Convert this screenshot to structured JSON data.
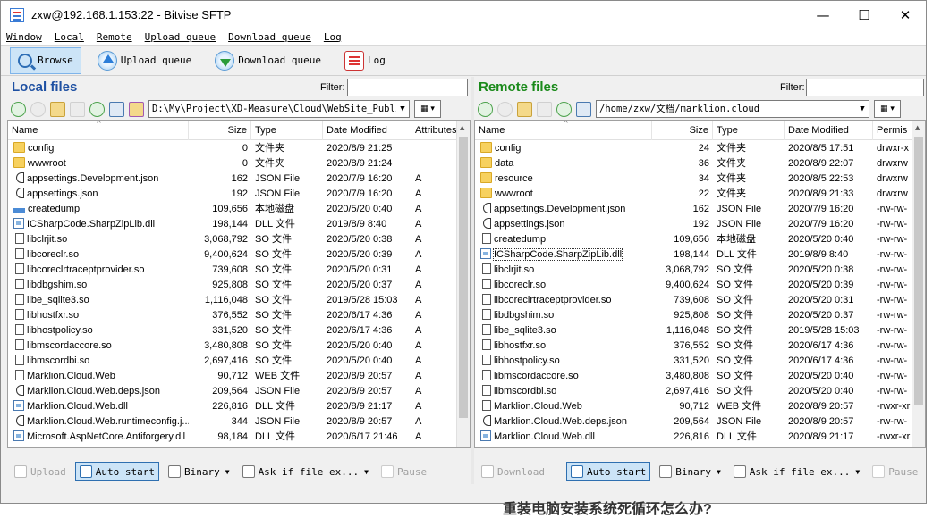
{
  "window": {
    "title": "zxw@192.168.1.153:22 - Bitvise SFTP",
    "minimize": "—",
    "maximize": "☐",
    "close": "✕"
  },
  "menu": [
    "Window",
    "Local",
    "Remote",
    "Upload queue",
    "Download queue",
    "Log"
  ],
  "toolbar": {
    "browse": "Browse",
    "upload_queue": "Upload queue",
    "download_queue": "Download queue",
    "log": "Log"
  },
  "local": {
    "title": "Local files",
    "filter_label": "Filter:",
    "filter_value": "",
    "path": "D:\\My\\Project\\XD-Measure\\Cloud\\WebSite_Publish",
    "columns": [
      "Name",
      "Size",
      "Type",
      "Date Modified",
      "Attributes"
    ],
    "rows": [
      {
        "icon": "folder",
        "name": "config",
        "size": "0",
        "type": "文件夹",
        "date": "2020/8/9 21:25",
        "attr": ""
      },
      {
        "icon": "folder",
        "name": "wwwroot",
        "size": "0",
        "type": "文件夹",
        "date": "2020/8/9 21:24",
        "attr": ""
      },
      {
        "icon": "json",
        "name": "appsettings.Development.json",
        "size": "162",
        "type": "JSON File",
        "date": "2020/7/9 16:20",
        "attr": "A"
      },
      {
        "icon": "json",
        "name": "appsettings.json",
        "size": "192",
        "type": "JSON File",
        "date": "2020/7/9 16:20",
        "attr": "A"
      },
      {
        "icon": "disk",
        "name": "createdump",
        "size": "109,656",
        "type": "本地磁盘",
        "date": "2020/5/20 0:40",
        "attr": "A"
      },
      {
        "icon": "dll",
        "name": "ICSharpCode.SharpZipLib.dll",
        "size": "198,144",
        "type": "DLL 文件",
        "date": "2019/8/9 8:40",
        "attr": "A"
      },
      {
        "icon": "file",
        "name": "libclrjit.so",
        "size": "3,068,792",
        "type": "SO 文件",
        "date": "2020/5/20 0:38",
        "attr": "A"
      },
      {
        "icon": "file",
        "name": "libcoreclr.so",
        "size": "9,400,624",
        "type": "SO 文件",
        "date": "2020/5/20 0:39",
        "attr": "A"
      },
      {
        "icon": "file",
        "name": "libcoreclrtraceptprovider.so",
        "size": "739,608",
        "type": "SO 文件",
        "date": "2020/5/20 0:31",
        "attr": "A"
      },
      {
        "icon": "file",
        "name": "libdbgshim.so",
        "size": "925,808",
        "type": "SO 文件",
        "date": "2020/5/20 0:37",
        "attr": "A"
      },
      {
        "icon": "file",
        "name": "libe_sqlite3.so",
        "size": "1,116,048",
        "type": "SO 文件",
        "date": "2019/5/28 15:03",
        "attr": "A"
      },
      {
        "icon": "file",
        "name": "libhostfxr.so",
        "size": "376,552",
        "type": "SO 文件",
        "date": "2020/6/17 4:36",
        "attr": "A"
      },
      {
        "icon": "file",
        "name": "libhostpolicy.so",
        "size": "331,520",
        "type": "SO 文件",
        "date": "2020/6/17 4:36",
        "attr": "A"
      },
      {
        "icon": "file",
        "name": "libmscordaccore.so",
        "size": "3,480,808",
        "type": "SO 文件",
        "date": "2020/5/20 0:40",
        "attr": "A"
      },
      {
        "icon": "file",
        "name": "libmscordbi.so",
        "size": "2,697,416",
        "type": "SO 文件",
        "date": "2020/5/20 0:40",
        "attr": "A"
      },
      {
        "icon": "file",
        "name": "Marklion.Cloud.Web",
        "size": "90,712",
        "type": "WEB 文件",
        "date": "2020/8/9 20:57",
        "attr": "A"
      },
      {
        "icon": "json",
        "name": "Marklion.Cloud.Web.deps.json",
        "size": "209,564",
        "type": "JSON File",
        "date": "2020/8/9 20:57",
        "attr": "A"
      },
      {
        "icon": "dll",
        "name": "Marklion.Cloud.Web.dll",
        "size": "226,816",
        "type": "DLL 文件",
        "date": "2020/8/9 21:17",
        "attr": "A"
      },
      {
        "icon": "json",
        "name": "Marklion.Cloud.Web.runtimeconfig.j...",
        "size": "344",
        "type": "JSON File",
        "date": "2020/8/9 20:57",
        "attr": "A"
      },
      {
        "icon": "dll",
        "name": "Microsoft.AspNetCore.Antiforgery.dll",
        "size": "98,184",
        "type": "DLL 文件",
        "date": "2020/6/17 21:46",
        "attr": "A"
      }
    ],
    "bottom": {
      "transfer": "Upload",
      "auto_start": "Auto start",
      "binary": "Binary",
      "ask": "Ask if file ex...",
      "pause": "Pause"
    }
  },
  "remote": {
    "title": "Remote files",
    "filter_label": "Filter:",
    "filter_value": "",
    "path": "/home/zxw/文档/marklion.cloud",
    "columns": [
      "Name",
      "Size",
      "Type",
      "Date Modified",
      "Permis"
    ],
    "rows": [
      {
        "icon": "folder",
        "name": "config",
        "size": "24",
        "type": "文件夹",
        "date": "2020/8/5 17:51",
        "attr": "drwxr-x"
      },
      {
        "icon": "folder",
        "name": "data",
        "size": "36",
        "type": "文件夹",
        "date": "2020/8/9 22:07",
        "attr": "drwxrw"
      },
      {
        "icon": "folder",
        "name": "resource",
        "size": "34",
        "type": "文件夹",
        "date": "2020/8/5 22:53",
        "attr": "drwxrw"
      },
      {
        "icon": "folder",
        "name": "wwwroot",
        "size": "22",
        "type": "文件夹",
        "date": "2020/8/9 21:33",
        "attr": "drwxrw"
      },
      {
        "icon": "json",
        "name": "appsettings.Development.json",
        "size": "162",
        "type": "JSON File",
        "date": "2020/7/9 16:20",
        "attr": "-rw-rw-"
      },
      {
        "icon": "json",
        "name": "appsettings.json",
        "size": "192",
        "type": "JSON File",
        "date": "2020/7/9 16:20",
        "attr": "-rw-rw-"
      },
      {
        "icon": "file",
        "name": "createdump",
        "size": "109,656",
        "type": "本地磁盘",
        "date": "2020/5/20 0:40",
        "attr": "-rw-rw-"
      },
      {
        "icon": "dll",
        "name": "ICSharpCode.SharpZipLib.dll",
        "size": "198,144",
        "type": "DLL 文件",
        "date": "2019/8/9 8:40",
        "attr": "-rw-rw-"
      },
      {
        "icon": "file",
        "name": "libclrjit.so",
        "size": "3,068,792",
        "type": "SO 文件",
        "date": "2020/5/20 0:38",
        "attr": "-rw-rw-"
      },
      {
        "icon": "file",
        "name": "libcoreclr.so",
        "size": "9,400,624",
        "type": "SO 文件",
        "date": "2020/5/20 0:39",
        "attr": "-rw-rw-"
      },
      {
        "icon": "file",
        "name": "libcoreclrtraceptprovider.so",
        "size": "739,608",
        "type": "SO 文件",
        "date": "2020/5/20 0:31",
        "attr": "-rw-rw-"
      },
      {
        "icon": "file",
        "name": "libdbgshim.so",
        "size": "925,808",
        "type": "SO 文件",
        "date": "2020/5/20 0:37",
        "attr": "-rw-rw-"
      },
      {
        "icon": "file",
        "name": "libe_sqlite3.so",
        "size": "1,116,048",
        "type": "SO 文件",
        "date": "2019/5/28 15:03",
        "attr": "-rw-rw-"
      },
      {
        "icon": "file",
        "name": "libhostfxr.so",
        "size": "376,552",
        "type": "SO 文件",
        "date": "2020/6/17 4:36",
        "attr": "-rw-rw-"
      },
      {
        "icon": "file",
        "name": "libhostpolicy.so",
        "size": "331,520",
        "type": "SO 文件",
        "date": "2020/6/17 4:36",
        "attr": "-rw-rw-"
      },
      {
        "icon": "file",
        "name": "libmscordaccore.so",
        "size": "3,480,808",
        "type": "SO 文件",
        "date": "2020/5/20 0:40",
        "attr": "-rw-rw-"
      },
      {
        "icon": "file",
        "name": "libmscordbi.so",
        "size": "2,697,416",
        "type": "SO 文件",
        "date": "2020/5/20 0:40",
        "attr": "-rw-rw-"
      },
      {
        "icon": "file",
        "name": "Marklion.Cloud.Web",
        "size": "90,712",
        "type": "WEB 文件",
        "date": "2020/8/9 20:57",
        "attr": "-rwxr-xr"
      },
      {
        "icon": "json",
        "name": "Marklion.Cloud.Web.deps.json",
        "size": "209,564",
        "type": "JSON File",
        "date": "2020/8/9 20:57",
        "attr": "-rw-rw-"
      },
      {
        "icon": "dll",
        "name": "Marklion.Cloud.Web.dll",
        "size": "226,816",
        "type": "DLL 文件",
        "date": "2020/8/9 21:17",
        "attr": "-rwxr-xr"
      }
    ],
    "bottom": {
      "transfer": "Download",
      "auto_start": "Auto start",
      "binary": "Binary",
      "ask": "Ask if file ex...",
      "pause": "Pause"
    }
  },
  "background_text": "重装电脑安装系统死循环怎么办?"
}
